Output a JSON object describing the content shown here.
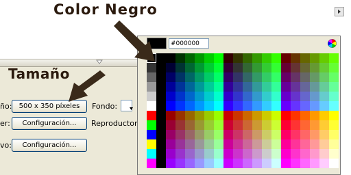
{
  "annotations": {
    "color_negro": "Color Negro",
    "tamano": "Tamaño"
  },
  "properties": {
    "size_label_fragment": "ño:",
    "size_button": "500 x 350 píxeles",
    "background_label": "Fondo:",
    "publish_label_fragment": "er:",
    "publish_settings_button": "Configuración...",
    "player_label": "Reproductor:",
    "profile_label_fragment": "vo:",
    "profile_settings_button": "Configuración..."
  },
  "color_picker": {
    "hex_value": "#000000",
    "selected_color": "#000000",
    "left_column_colors": [
      "#000000",
      "#333333",
      "#666666",
      "#999999",
      "#cccccc",
      "#ffffff",
      "#ff0000",
      "#00ff00",
      "#0000ff",
      "#ffff00",
      "#00ffff",
      "#ff00ff"
    ],
    "spacer_color": "#000000",
    "levels": [
      "00",
      "33",
      "66",
      "99",
      "cc",
      "ff"
    ]
  },
  "icons": {
    "color_wheel": "color-wheel-icon",
    "scroll_arrow": "scroll-right-icon",
    "collapse": "collapse-triangle-icon",
    "dropdown": "dropdown-arrow-icon"
  },
  "colors": {
    "panel_bg": "#ece9d8",
    "button_border": "#003c74",
    "annotation_text": "#2b1a0e",
    "arrow": "#3a2a1a"
  }
}
